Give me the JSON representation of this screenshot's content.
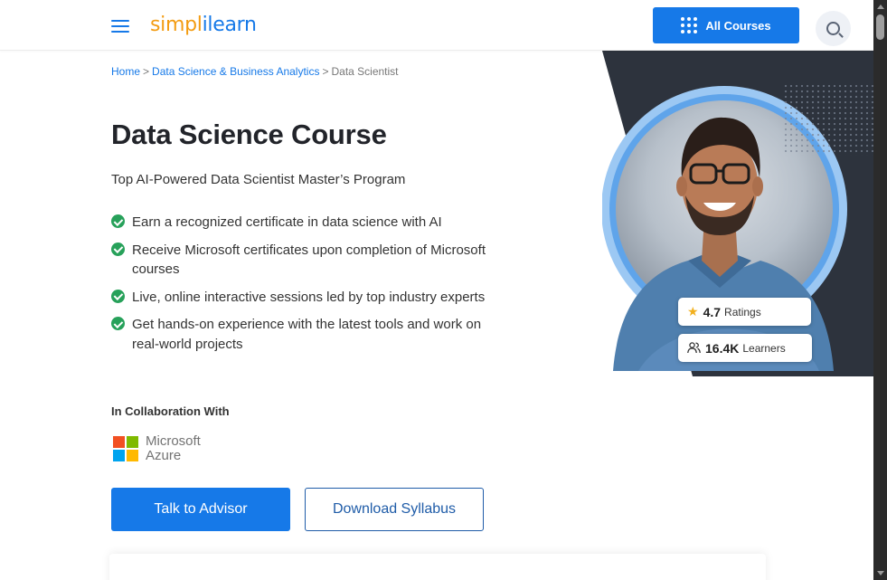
{
  "header": {
    "logo_part1": "simpl",
    "logo_part2": "ilearn",
    "all_courses_label": "All Courses",
    "menu_icon": "hamburger-icon",
    "search_icon": "search-icon"
  },
  "breadcrumb": {
    "items": [
      "Home",
      "Data Science & Business Analytics",
      "Data Scientist"
    ],
    "separator": ">"
  },
  "hero": {
    "title": "Data Science Course",
    "subtitle": "Top AI-Powered Data Scientist Master’s Program",
    "features": [
      "Earn a recognized certificate in data science with AI",
      "Receive Microsoft certificates upon completion of Microsoft courses",
      "Live, online interactive sessions led by top industry experts",
      "Get hands-on experience with the latest tools and work on real-world projects"
    ],
    "collab_label": "In Collaboration With",
    "partner_line1": "Microsoft",
    "partner_line2": "Azure",
    "advisor_button": "Talk to Advisor",
    "syllabus_button": "Download Syllabus",
    "rating_value": "4.7",
    "rating_label": "Ratings",
    "learners_value": "16.4K",
    "learners_label": "Learners"
  },
  "colors": {
    "brand_blue": "#1679e8",
    "brand_orange": "#f39c12",
    "check_green": "#27a15a",
    "hero_dark": "#2d333d",
    "ring_blue": "#9cc8f3"
  }
}
